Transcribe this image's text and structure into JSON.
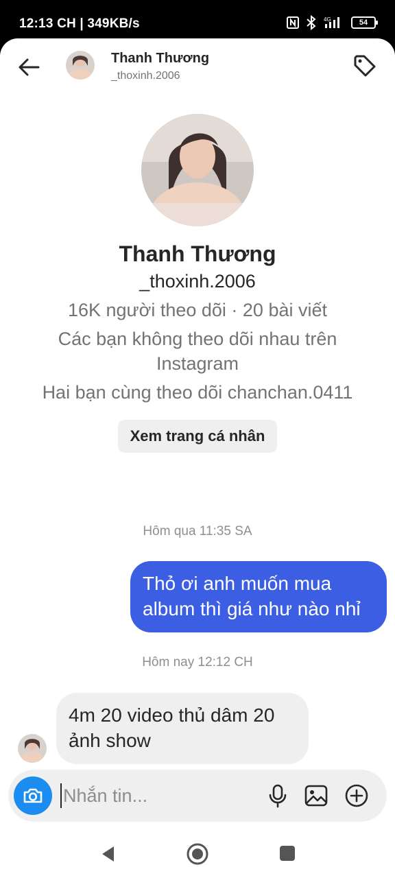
{
  "status_bar": {
    "time": "12:13 CH | 349KB/s",
    "battery": "54"
  },
  "header": {
    "name": "Thanh Thương",
    "username": "_thoxinh.2006"
  },
  "profile": {
    "name": "Thanh Thương",
    "username": "_thoxinh.2006",
    "stats": "16K người theo dõi · 20 bài viết",
    "follow_note_line1": "Các bạn không theo dõi nhau trên",
    "follow_note_line2": "Instagram",
    "mutual": "Hai bạn cùng theo dõi chanchan.0411",
    "view_profile_label": "Xem trang cá nhân"
  },
  "messages": {
    "timestamp_1": "Hôm qua 11:35 SA",
    "outgoing_1": "Thỏ ơi anh muốn mua album thì giá như nào nhỉ",
    "timestamp_2": "Hôm nay 12:12 CH",
    "incoming_1": "4m 20 video thủ dâm 20 ảnh show"
  },
  "composer": {
    "placeholder": "Nhắn tin..."
  },
  "icons": {
    "back": "arrow-left-icon",
    "tag": "tag-icon",
    "camera": "camera-icon",
    "mic": "microphone-icon",
    "gallery": "image-icon",
    "add": "plus-circle-icon"
  },
  "colors": {
    "outgoing_bubble": "#3b5ee3",
    "camera_button": "#1d8cf0",
    "incoming_bubble": "#efefef"
  }
}
